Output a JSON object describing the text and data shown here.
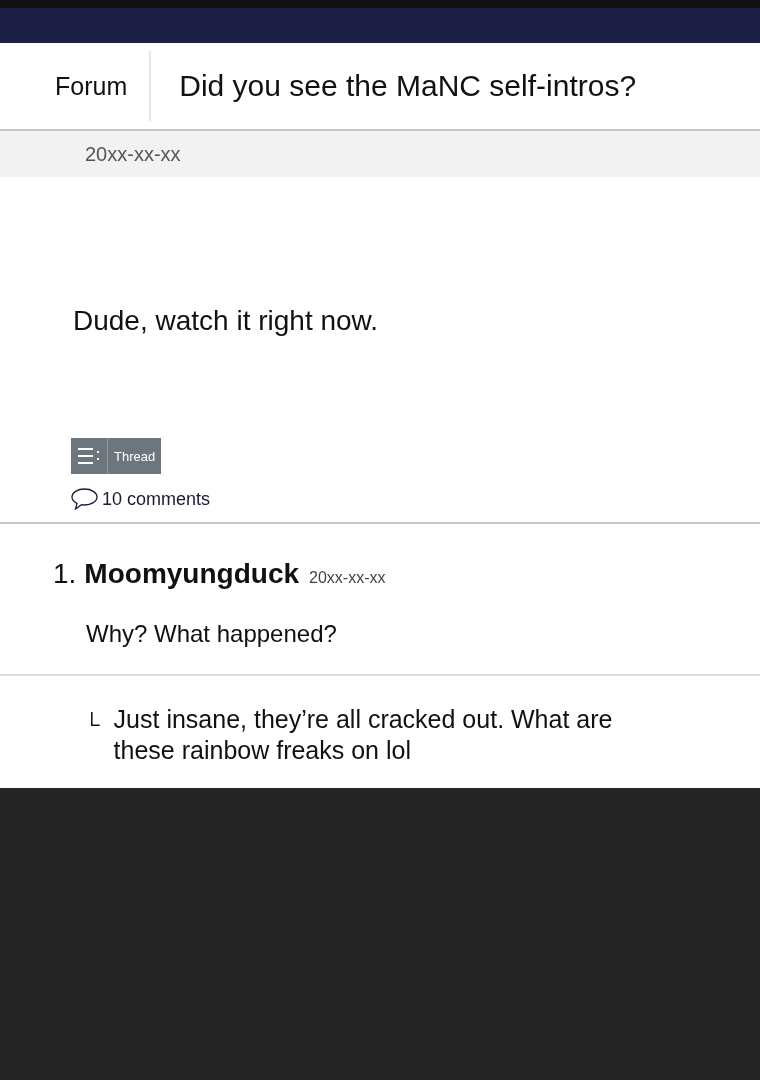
{
  "header": {
    "section": "Forum",
    "title": "Did you see the MaNC self-intros?"
  },
  "post": {
    "date": "20xx-xx-xx",
    "body": "Dude, watch it right now.",
    "thread_button": "Thread",
    "comment_count": "10 comments"
  },
  "comments": [
    {
      "number": "1.",
      "author": "Moomyungduck",
      "date": "20xx-xx-xx",
      "text": "Why? What happened?"
    }
  ],
  "replies": [
    {
      "marker": "└",
      "text": "Just insane, they’re all cracked out. What are these rainbow freaks on lol"
    }
  ]
}
